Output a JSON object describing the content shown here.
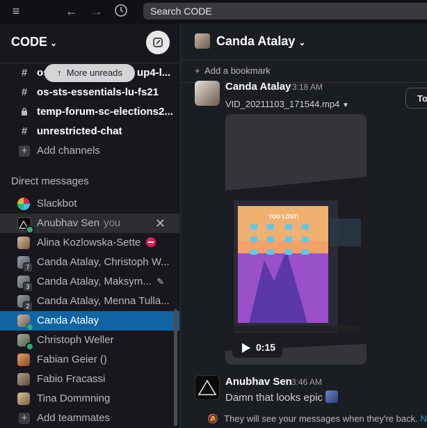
{
  "search": {
    "placeholder": "Search CODE"
  },
  "workspace": {
    "name": "CODE"
  },
  "more_unreads": "More unreads",
  "channels": [
    {
      "name": "os-sts-essentials-lu-fs21",
      "prefix": "#",
      "bold": true
    },
    {
      "name": "temp-forum-sc-elections2...",
      "prefix": "lock",
      "bold": true
    },
    {
      "name": "unrestricted-chat",
      "prefix": "#",
      "bold": true
    }
  ],
  "channel_partial": {
    "prefix": "#",
    "left": "os",
    "right": "up4-l..."
  },
  "add_channels": "Add channels",
  "dm_header": "Direct messages",
  "dms": [
    {
      "name": "Slackbot"
    },
    {
      "name": "Anubhav Sen",
      "you": "you"
    },
    {
      "name": "Alina Kozlowska-Sette"
    },
    {
      "name": "Canda Atalay, Christoph W...",
      "count": "7"
    },
    {
      "name": "Canda Atalay, Maksym...",
      "count": "3"
    },
    {
      "name": "Canda Atalay, Menna Tulla...",
      "count": "2"
    },
    {
      "name": "Canda Atalay"
    },
    {
      "name": "Christoph Weller"
    },
    {
      "name": "Fabian Geier ()"
    },
    {
      "name": "Fabio Fracassi"
    },
    {
      "name": "Tina Dommning"
    }
  ],
  "add_teammates": "Add teammates",
  "channel": {
    "title": "Canda Atalay",
    "bookmark": "Add a bookmark"
  },
  "messages": [
    {
      "author": "Canda Atalay",
      "time": "3:18 AM",
      "file": "VID_20211103_171544.mp4",
      "duration": "0:15"
    },
    {
      "author": "Anubhav Sen",
      "time": "3:46 AM",
      "text": "Damn that looks epic"
    }
  ],
  "side_pill": "To",
  "video_game_text": "YOU LOST!",
  "notice": {
    "text": "They will see your messages when they're back.",
    "link": "No"
  }
}
